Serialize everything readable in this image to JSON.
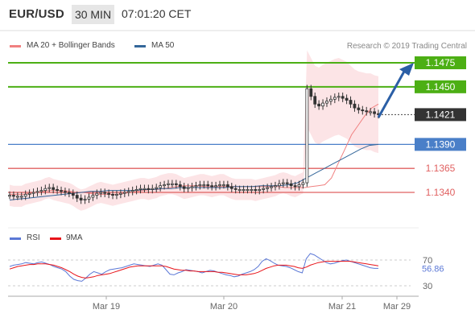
{
  "header": {
    "symbol": "EUR/USD",
    "timeframe": "30 MIN",
    "time": "07:01:20 CET"
  },
  "legend_main": {
    "ma20_label": "MA 20 + Bollinger Bands",
    "ma50_label": "MA 50",
    "ma20_color": "#f08080",
    "ma50_color": "#34679a",
    "credit": "Research © 2019 Trading Central"
  },
  "legend_rsi": {
    "rsi_label": "RSI",
    "ma_label": "9MA",
    "rsi_color": "#5b78d6",
    "ma_color": "#e8141a"
  },
  "colors": {
    "resistance": "#4caf14",
    "support": "#e06060",
    "pivot": "#4a7fc8",
    "current": "#333333",
    "arrow": "#2b5fa6",
    "bands_fill": "#fce4e6",
    "candle": "#333333"
  },
  "levels": [
    {
      "value": 1.1475,
      "label": "1.1475",
      "kind": "resistance"
    },
    {
      "value": 1.145,
      "label": "1.1450",
      "kind": "resistance"
    },
    {
      "value": 1.1421,
      "label": "1.1421",
      "kind": "current"
    },
    {
      "value": 1.139,
      "label": "1.1390",
      "kind": "pivot"
    },
    {
      "value": 1.1365,
      "label": "1.1365",
      "kind": "support"
    },
    {
      "value": 1.134,
      "label": "1.1340",
      "kind": "support"
    }
  ],
  "rsi_ticks": [
    {
      "value": 70,
      "label": "70"
    },
    {
      "value": 30,
      "label": "30"
    }
  ],
  "rsi_current": "56.86",
  "x_labels": [
    "Mar 19",
    "Mar 20",
    "Mar 21",
    "Mar 29"
  ],
  "chart_data": {
    "type": "line",
    "subtype": "candlestick",
    "title": "EUR/USD 30 MIN",
    "xlabel": "",
    "ylabel": "",
    "ylim": [
      1.1325,
      1.1485
    ],
    "categories": [
      "Mar 19",
      "Mar 20",
      "Mar 21",
      "Mar 29"
    ],
    "close_series": [
      1.1337,
      1.1336,
      1.1336,
      1.1336,
      1.1338,
      1.1339,
      1.134,
      1.1341,
      1.1342,
      1.1344,
      1.1345,
      1.1343,
      1.1342,
      1.1341,
      1.134,
      1.1339,
      1.1337,
      1.1334,
      1.1332,
      1.1333,
      1.1335,
      1.1337,
      1.1339,
      1.134,
      1.1339,
      1.1338,
      1.1337,
      1.1338,
      1.1339,
      1.134,
      1.1341,
      1.1342,
      1.1343,
      1.1344,
      1.1344,
      1.1343,
      1.1344,
      1.1345,
      1.1347,
      1.1348,
      1.1349,
      1.1349,
      1.1348,
      1.1346,
      1.1344,
      1.1345,
      1.1346,
      1.1347,
      1.1348,
      1.1348,
      1.1347,
      1.1346,
      1.1347,
      1.1348,
      1.1348,
      1.1346,
      1.1344,
      1.1343,
      1.1343,
      1.1343,
      1.1343,
      1.1343,
      1.1342,
      1.1343,
      1.1344,
      1.1345,
      1.1346,
      1.1347,
      1.1349,
      1.135,
      1.1349,
      1.1347,
      1.1346,
      1.1348,
      1.135,
      1.1448,
      1.144,
      1.1432,
      1.143,
      1.1433,
      1.1435,
      1.1437,
      1.1439,
      1.144,
      1.1438,
      1.1436,
      1.1432,
      1.1428,
      1.1426,
      1.1425,
      1.1424,
      1.1424,
      1.1422,
      1.1421
    ],
    "series": [
      {
        "name": "MA 20",
        "values": [
          1.1338,
          1.1338,
          1.1338,
          1.1339,
          1.134,
          1.1341,
          1.1342,
          1.1342,
          1.1342,
          1.1341,
          1.134,
          1.134,
          1.1339,
          1.1338,
          1.1338,
          1.1338,
          1.1338,
          1.1339,
          1.134,
          1.1341,
          1.1342,
          1.1343,
          1.1343,
          1.1344,
          1.1345,
          1.1346,
          1.1347,
          1.1347,
          1.1347,
          1.1346,
          1.1346,
          1.1346,
          1.1346,
          1.1346,
          1.1346,
          1.1346,
          1.1346,
          1.1346,
          1.1346,
          1.1346,
          1.1346,
          1.1345,
          1.1345,
          1.1345,
          1.1345,
          1.1346,
          1.1347,
          1.1348,
          1.1355,
          1.137,
          1.1385,
          1.14,
          1.141,
          1.142,
          1.1428,
          1.1432
        ]
      },
      {
        "name": "MA 50",
        "values": [
          1.1332,
          1.1333,
          1.1334,
          1.1335,
          1.1336,
          1.1337,
          1.1338,
          1.1339,
          1.134,
          1.1341,
          1.1341,
          1.1342,
          1.1342,
          1.1342,
          1.1342,
          1.1343,
          1.1343,
          1.1344,
          1.1344,
          1.1345,
          1.1345,
          1.1345,
          1.1345,
          1.1345,
          1.1345,
          1.1346,
          1.1346,
          1.1346,
          1.1347,
          1.1347,
          1.1347,
          1.1348,
          1.135,
          1.1355,
          1.136,
          1.1365,
          1.137,
          1.1375,
          1.138,
          1.1385,
          1.1389,
          1.139
        ]
      },
      {
        "name": "RSI",
        "values": [
          60,
          62,
          63,
          64,
          66,
          65,
          64,
          66,
          67,
          65,
          63,
          60,
          58,
          56,
          52,
          45,
          40,
          38,
          37,
          42,
          48,
          52,
          50,
          48,
          52,
          55,
          56,
          57,
          58,
          60,
          62,
          64,
          63,
          62,
          61,
          60,
          62,
          64,
          62,
          55,
          48,
          47,
          50,
          52,
          55,
          54,
          53,
          52,
          50,
          52,
          54,
          53,
          51,
          49,
          47,
          46,
          44,
          45,
          48,
          50,
          52,
          55,
          60,
          68,
          72,
          69,
          65,
          62,
          61,
          60,
          58,
          55,
          52,
          50,
          72,
          80,
          78,
          74,
          70,
          66,
          64,
          65,
          67,
          69,
          70,
          68,
          66,
          64,
          62,
          60,
          58,
          57,
          57
        ]
      },
      {
        "name": "9MA",
        "values": [
          56,
          58,
          60,
          61,
          62,
          63,
          63,
          64,
          64,
          64,
          63,
          62,
          60,
          58,
          55,
          52,
          48,
          45,
          43,
          42,
          43,
          44,
          46,
          47,
          48,
          49,
          51,
          53,
          55,
          57,
          59,
          60,
          61,
          61,
          61,
          61,
          61,
          61,
          61,
          60,
          58,
          56,
          55,
          54,
          54,
          53,
          53,
          52,
          52,
          52,
          52,
          52,
          51,
          51,
          50,
          49,
          48,
          47,
          47,
          47,
          48,
          49,
          51,
          54,
          57,
          59,
          61,
          62,
          62,
          62,
          61,
          60,
          58,
          57,
          59,
          62,
          64,
          66,
          67,
          68,
          68,
          68,
          68,
          68,
          68,
          68,
          67,
          66,
          65,
          64,
          63,
          62,
          61
        ]
      }
    ]
  }
}
